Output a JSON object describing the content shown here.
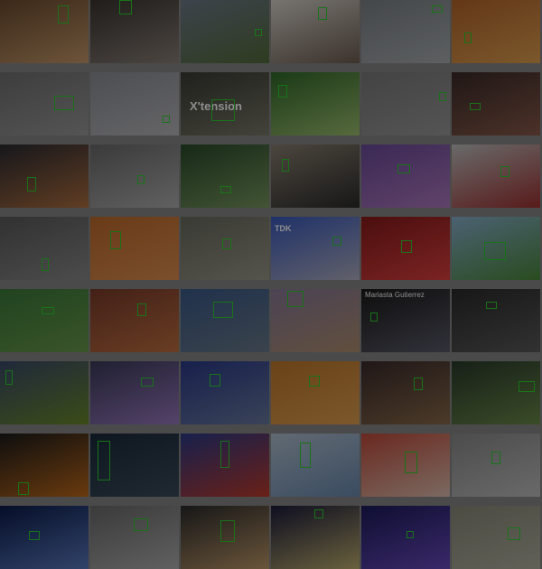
{
  "grid": {
    "rows": 8,
    "cols": 6
  },
  "box_color": "#2bd12b",
  "tile_texts": {
    "xtension": "X'tension",
    "tdk": "TDK",
    "mariasta": "Mariasta Gutierrez"
  },
  "tiles": [
    {
      "id": "r1c1",
      "scene": "person-with-raised-hand-indoors",
      "bg": [
        "#6b4a2e",
        "#c79a6a"
      ]
    },
    {
      "id": "r1c2",
      "scene": "child-in-kitchen",
      "bg": [
        "#3a3430",
        "#8a8078"
      ]
    },
    {
      "id": "r1c3",
      "scene": "sheep-in-field",
      "bg": [
        "#6f7a8a",
        "#556b3a"
      ]
    },
    {
      "id": "r1c4",
      "scene": "person-in-white-room",
      "bg": [
        "#d8d3cc",
        "#6d5d50"
      ]
    },
    {
      "id": "r1c5",
      "scene": "road-aerial",
      "bg": [
        "#7c8286",
        "#a9aeb0"
      ]
    },
    {
      "id": "r1c6",
      "scene": "basketball-court",
      "bg": [
        "#b5652a",
        "#e0a050"
      ]
    },
    {
      "id": "r2c1",
      "scene": "gray-textured-surface",
      "bg": [
        "#6f6f6f",
        "#9a9a9a"
      ]
    },
    {
      "id": "r2c2",
      "scene": "gravel-ground",
      "bg": [
        "#8c8e94",
        "#b8b8bc"
      ]
    },
    {
      "id": "r2c3",
      "scene": "xtension-screen",
      "bg": [
        "#3a3a34",
        "#7a7a6a"
      ]
    },
    {
      "id": "r2c4",
      "scene": "green-plant",
      "bg": [
        "#2f6a2a",
        "#9fc070"
      ]
    },
    {
      "id": "r2c5",
      "scene": "gray-ground-bird",
      "bg": [
        "#7a7a7a",
        "#9a9a9a"
      ]
    },
    {
      "id": "r2c6",
      "scene": "crowd-event",
      "bg": [
        "#3a2a28",
        "#8a5a4a"
      ]
    },
    {
      "id": "r3c1",
      "scene": "basketball-arena",
      "bg": [
        "#2a2a30",
        "#b07040"
      ]
    },
    {
      "id": "r3c2",
      "scene": "hallway-grayscale",
      "bg": [
        "#6a6a6a",
        "#b0b0b0"
      ]
    },
    {
      "id": "r3c3",
      "scene": "hedge-garden",
      "bg": [
        "#2a4a2a",
        "#7a9a60"
      ]
    },
    {
      "id": "r3c4",
      "scene": "street-corner",
      "bg": [
        "#8a8070",
        "#2a2a2a"
      ]
    },
    {
      "id": "r3c5",
      "scene": "purple-flowers",
      "bg": [
        "#6a4a9a",
        "#b07ac0"
      ]
    },
    {
      "id": "r3c6",
      "scene": "group-of-people",
      "bg": [
        "#c0c0c0",
        "#a03030"
      ]
    },
    {
      "id": "r4c1",
      "scene": "dark-tree",
      "bg": [
        "#5a5a5a",
        "#8a8a8a"
      ]
    },
    {
      "id": "r4c2",
      "scene": "dog-on-sidewalk",
      "bg": [
        "#c06a2a",
        "#e09050"
      ]
    },
    {
      "id": "r4c3",
      "scene": "outdoor-yard",
      "bg": [
        "#6a6a60",
        "#9a9a8a"
      ]
    },
    {
      "id": "r4c4",
      "scene": "stadium-blue-seats",
      "bg": [
        "#3a5abf",
        "#b0b0c0"
      ]
    },
    {
      "id": "r4c5",
      "scene": "red-team-celebration",
      "bg": [
        "#8a1a1a",
        "#e04040"
      ]
    },
    {
      "id": "r4c6",
      "scene": "red-helicopter-field",
      "bg": [
        "#8ab0d0",
        "#4a8a3a"
      ]
    },
    {
      "id": "r5c1",
      "scene": "green-grass-field",
      "bg": [
        "#3a7a3a",
        "#6a9a4a"
      ]
    },
    {
      "id": "r5c2",
      "scene": "running-track",
      "bg": [
        "#7a3a2a",
        "#c07040"
      ]
    },
    {
      "id": "r5c3",
      "scene": "city-traffic",
      "bg": [
        "#3a5a8a",
        "#6a7a8a"
      ]
    },
    {
      "id": "r5c4",
      "scene": "evening-sky-building",
      "bg": [
        "#8a7a9a",
        "#b09070"
      ]
    },
    {
      "id": "r5c5",
      "scene": "mariasta-broadcast",
      "bg": [
        "#1a1a1a",
        "#5a5a6a"
      ]
    },
    {
      "id": "r5c6",
      "scene": "dark-wall",
      "bg": [
        "#2a2a2a",
        "#5a5a5a"
      ]
    },
    {
      "id": "r6c1",
      "scene": "football-field",
      "bg": [
        "#3a4a6a",
        "#6a8a2a"
      ]
    },
    {
      "id": "r6c2",
      "scene": "purple-blossoms",
      "bg": [
        "#3a3a5a",
        "#9a7ac0"
      ]
    },
    {
      "id": "r6c3",
      "scene": "office-chair",
      "bg": [
        "#2a3a8a",
        "#6a7aa0"
      ]
    },
    {
      "id": "r6c4",
      "scene": "indoor-gym",
      "bg": [
        "#c07a2a",
        "#e0a050"
      ]
    },
    {
      "id": "r6c5",
      "scene": "indoor-hall",
      "bg": [
        "#3a2a2a",
        "#8a6a4a"
      ]
    },
    {
      "id": "r6c6",
      "scene": "green-bush",
      "bg": [
        "#2a3a2a",
        "#6a8a4a"
      ]
    },
    {
      "id": "r7c1",
      "scene": "orange-flowers",
      "bg": [
        "#1a1a1a",
        "#c06a1a"
      ]
    },
    {
      "id": "r7c2",
      "scene": "concert-stage",
      "bg": [
        "#1a2a3a",
        "#3a4a5a"
      ]
    },
    {
      "id": "r7c3",
      "scene": "tennis-court",
      "bg": [
        "#2a3a8a",
        "#c03a2a"
      ]
    },
    {
      "id": "r7c4",
      "scene": "basketball-player",
      "bg": [
        "#b0c0d0",
        "#6a8ab0"
      ]
    },
    {
      "id": "r7c5",
      "scene": "sports-match",
      "bg": [
        "#c04a3a",
        "#e0c0b0"
      ]
    },
    {
      "id": "r7c6",
      "scene": "parking-lot",
      "bg": [
        "#8a8a8a",
        "#c0c0c0"
      ]
    },
    {
      "id": "r8c1",
      "scene": "concert-lights",
      "bg": [
        "#0a1a4a",
        "#5a7ac0"
      ]
    },
    {
      "id": "r8c2",
      "scene": "person-waving",
      "bg": [
        "#6a6a6a",
        "#b0b0b0"
      ]
    },
    {
      "id": "r8c3",
      "scene": "dance-floor",
      "bg": [
        "#2a2a2a",
        "#c09a6a"
      ]
    },
    {
      "id": "r8c4",
      "scene": "stage-spotlight",
      "bg": [
        "#1a1a3a",
        "#c0b070"
      ]
    },
    {
      "id": "r8c5",
      "scene": "concert-crowd",
      "bg": [
        "#1a1a5a",
        "#6a4ac0"
      ]
    },
    {
      "id": "r8c6",
      "scene": "bike-race",
      "bg": [
        "#8a8a7a",
        "#b0b0a0"
      ]
    }
  ]
}
